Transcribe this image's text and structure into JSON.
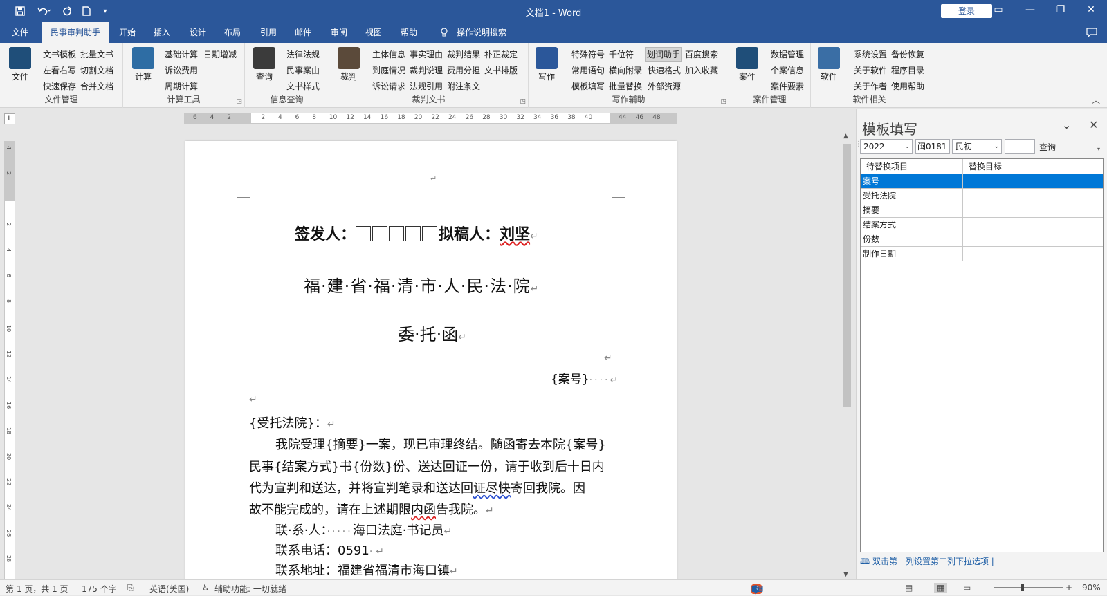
{
  "titlebar": {
    "doc_title": "文档1 - Word",
    "login": "登录",
    "qa_icons": [
      "save-icon",
      "undo-icon",
      "redo-icon",
      "new-doc-icon",
      "customize-icon"
    ]
  },
  "tabs": [
    "文件",
    "民事审判助手",
    "开始",
    "插入",
    "设计",
    "布局",
    "引用",
    "邮件",
    "审阅",
    "视图",
    "帮助",
    "操作说明搜索"
  ],
  "ribbon": {
    "groups": [
      {
        "label": "文件管理",
        "big": "文件",
        "items": [
          "文书模板",
          "批量文书",
          "左看右写",
          "切割文档",
          "快速保存",
          "合并文档"
        ]
      },
      {
        "label": "计算工具",
        "big": "计算",
        "items": [
          "基础计算",
          "日期增减",
          "诉讼费用",
          "周期计算"
        ]
      },
      {
        "label": "信息查询",
        "big": "查询",
        "items": [
          "法律法规",
          "民事案由",
          "文书样式"
        ]
      },
      {
        "label": "裁判文书",
        "big": "裁判",
        "items": [
          "主体信息",
          "事实理由",
          "裁判结果",
          "补正裁定",
          "到庭情况",
          "裁判说理",
          "费用分担",
          "文书排版",
          "诉讼请求",
          "法规引用",
          "附注条文"
        ]
      },
      {
        "label": "写作辅助",
        "big": "写作",
        "items": [
          "特殊符号",
          "千位符",
          "划词助手",
          "百度搜索",
          "常用语句",
          "横向附录",
          "快速格式",
          "加入收藏",
          "模板填写",
          "批量替换",
          "外部资源"
        ]
      },
      {
        "label": "案件管理",
        "big": "案件",
        "items": [
          "数据管理",
          "个案信息",
          "案件要素"
        ]
      },
      {
        "label": "软件相关",
        "big": "软件",
        "items": [
          "系统设置",
          "备份恢复",
          "关于软件",
          "程序目录",
          "关于作者",
          "使用帮助"
        ]
      }
    ]
  },
  "ruler": {
    "h_ticks": [
      "6",
      "4",
      "2",
      "",
      "2",
      "4",
      "6",
      "8",
      "10",
      "12",
      "14",
      "16",
      "18",
      "20",
      "22",
      "24",
      "26",
      "28",
      "30",
      "32",
      "34",
      "36",
      "38",
      "40",
      "",
      "44",
      "46",
      "48"
    ],
    "v_ticks": [
      "4",
      "2",
      "",
      "2",
      "4",
      "6",
      "8",
      "10",
      "12",
      "14",
      "16",
      "18",
      "20",
      "22",
      "24",
      "26",
      "28"
    ]
  },
  "doc": {
    "para_mark": "↵",
    "signer": "签发人：",
    "drafter": "拟稿人：",
    "drafter_name": "刘坚",
    "court": "福·建·省·福·清·市·人·民·法·院",
    "title": "委·托·函",
    "case_no": "{案号}",
    "recipient": "{受托法院}：",
    "body1": "我院受理{摘要}一案，现已审理终结。随函寄去本院{案号}",
    "body2": "民事{结案方式}书{份数}份、送达回证一份，请于收到后十日内",
    "body3a": "代为宣判和送达，并将宣判笔录和送达回",
    "body3b": "证尽快",
    "body3c": "寄回我院。因",
    "body4a": "故不能完成的，请在上述期限",
    "body4b": "内函",
    "body4c": "告我院。",
    "contact_label": "联·系·人：",
    "contact_value": "海口法庭·书记员",
    "phone_label": "联系电话：",
    "phone_value": "0591",
    "addr_label": "联系地址：",
    "addr_value": "福建省福清市海口镇"
  },
  "pane": {
    "title": "模板填写",
    "year": "2022",
    "court_code": "闽0181",
    "case_type": "民初",
    "number": "",
    "query": "查询",
    "col1": "待替换项目",
    "col2": "替换目标",
    "rows": [
      {
        "item": "案号",
        "target": ""
      },
      {
        "item": "受托法院",
        "target": ""
      },
      {
        "item": "摘要",
        "target": ""
      },
      {
        "item": "结案方式",
        "target": ""
      },
      {
        "item": "份数",
        "target": ""
      },
      {
        "item": "制作日期",
        "target": ""
      }
    ],
    "hint": "双击第一列设置第二列下拉选项"
  },
  "status": {
    "page": "第 1 页，共 1 页",
    "words": "175 个字",
    "lang": "英语(美国)",
    "access": "辅助功能: 一切就绪",
    "ime": "中",
    "zoom": "90%"
  }
}
